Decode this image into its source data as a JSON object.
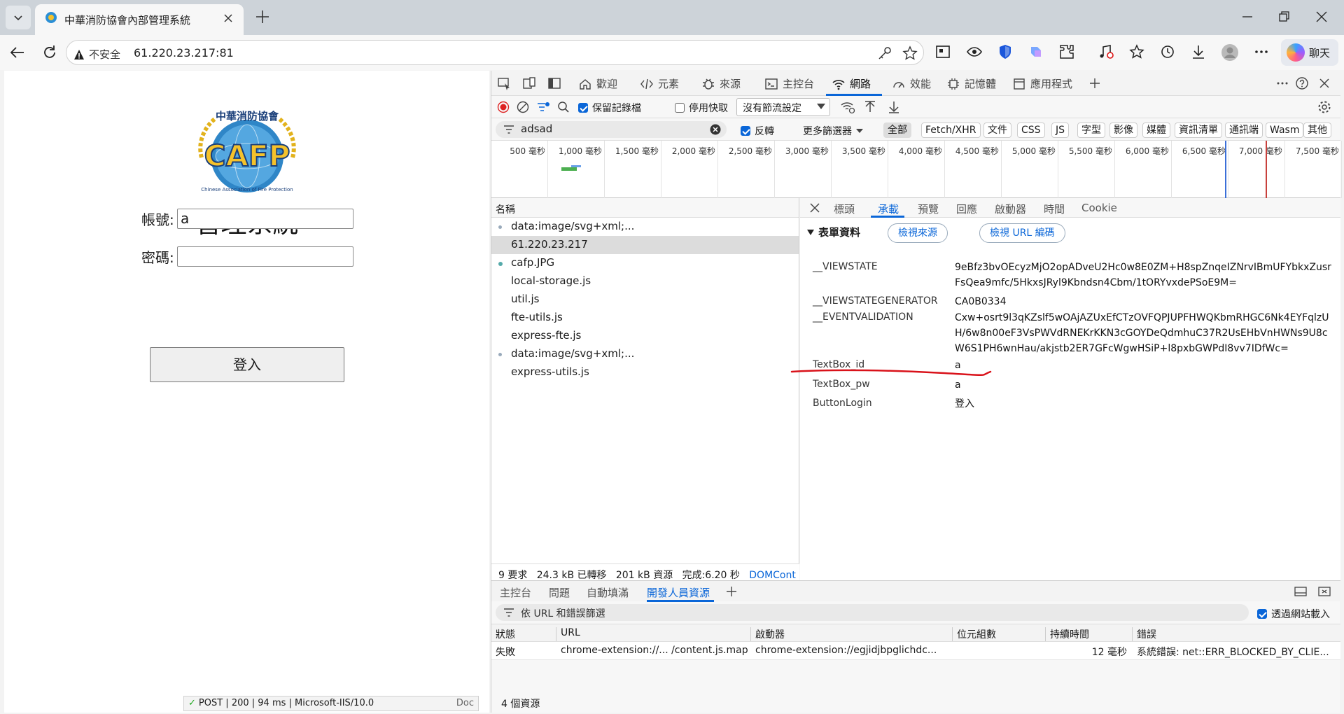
{
  "browser": {
    "tab_title": "中華消防協會內部管理系統",
    "security_label": "不安全",
    "url": "61.220.23.217:81",
    "chat_label": "聊天"
  },
  "page": {
    "logo_text": "CAFP",
    "logo_top_text": "中華消防協會",
    "logo_ring_text": "Chinese Association of Fire Protection",
    "title": "管理系統",
    "username_label": "帳號:",
    "username_value": "a",
    "password_label": "密碼:",
    "password_value": "",
    "login_button": "登入",
    "ext_status": "POST | 200 | 94 ms | Microsoft-IIS/10.0",
    "ext_doc": "Doc"
  },
  "devtools": {
    "tabs": [
      "歡迎",
      "元素",
      "來源",
      "主控台",
      "網路",
      "效能",
      "記憶體",
      "應用程式"
    ],
    "preserve_log": "保留記錄檔",
    "disable_cache": "停用快取",
    "throttle": "沒有節流設定",
    "filter_value": "adsad",
    "invert": "反轉",
    "more_filters": "更多篩選器",
    "type_chips": [
      "全部",
      "Fetch/XHR",
      "文件",
      "CSS",
      "JS",
      "字型",
      "影像",
      "媒體",
      "資訊清單",
      "通訊端",
      "Wasm",
      "其他"
    ],
    "timeline_ticks": [
      "500 毫秒",
      "1,000 毫秒",
      "1,500 毫秒",
      "2,000 毫秒",
      "2,500 毫秒",
      "3,000 毫秒",
      "3,500 毫秒",
      "4,000 毫秒",
      "4,500 毫秒",
      "5,000 毫秒",
      "5,500 毫秒",
      "6,000 毫秒",
      "6,500 毫秒",
      "7,000 毫秒",
      "7,500 毫秒"
    ],
    "name_header": "名稱",
    "requests": [
      "data:image/svg+xml;...",
      "61.220.23.217",
      "cafp.JPG",
      "local-storage.js",
      "util.js",
      "fte-utils.js",
      "express-fte.js",
      "data:image/svg+xml;...",
      "express-utils.js"
    ],
    "status_bar": {
      "requests": "9 要求",
      "transferred": "24.3 kB 已轉移",
      "resources": "201 kB 資源",
      "finish": "完成:6.20 秒",
      "domcontent": "DOMCont"
    },
    "detail_tabs": [
      "標頭",
      "承載",
      "預覽",
      "回應",
      "啟動器",
      "時間",
      "Cookie"
    ],
    "form_data_title": "表單資料",
    "view_source": "檢視來源",
    "view_url_encoded": "檢視 URL 編碼",
    "form_fields": [
      {
        "key": "__VIEWSTATE",
        "value": "9eBfz3bvOEcyzMjO2opADveU2Hc0w8E0ZM+H8spZnqeIZNrvIBmUFYbkxZusrFsQea9mfc/5HkxsJRyl9Kbndsn4Cbm/1tORYvxdePSoE9M="
      },
      {
        "key": "__VIEWSTATEGENERATOR",
        "value": "CA0B0334"
      },
      {
        "key": "__EVENTVALIDATION",
        "value": "Cxw+osrt9l3qKZslf5wOAjAZUxEfCTzOVFQPJUPFHWQKbmRHGC6Nk4EYFqlzUH/6w8n00eF3VsPWVdRNEKrKKN3cGOYDeQdmhuC37R2UsEHbVnHWNs9U8cW6S1PH6wnHau/akjstb2ER7GFcWgwHSiP+l8pxbGWPdI8vv7IDfWc="
      },
      {
        "key": "TextBox_id",
        "value": "a"
      },
      {
        "key": "TextBox_pw",
        "value": "a"
      },
      {
        "key": "ButtonLogin",
        "value": "登入"
      }
    ],
    "drawer_tabs": [
      "主控台",
      "問題",
      "自動填滿",
      "開發人員資源"
    ],
    "drawer_filter": "依 URL 和錯誤篩選",
    "show_ext_loads": "透過網站載入",
    "issue_headers": [
      "狀態",
      "URL",
      "啟動器",
      "位元組數",
      "持續時間",
      "錯誤"
    ],
    "issue_row": {
      "status": "失敗",
      "url": "chrome-extension://... /content.js.map",
      "initiator": "chrome-extension://egjidjbpglichdc...",
      "bytes": "",
      "duration": "12 毫秒",
      "error": "系統錯誤: net::ERR_BLOCKED_BY_CLIE..."
    },
    "resource_count": "4 個資源"
  },
  "colors": {
    "accent": "#0a66d8",
    "annotation": "#d9121a"
  }
}
